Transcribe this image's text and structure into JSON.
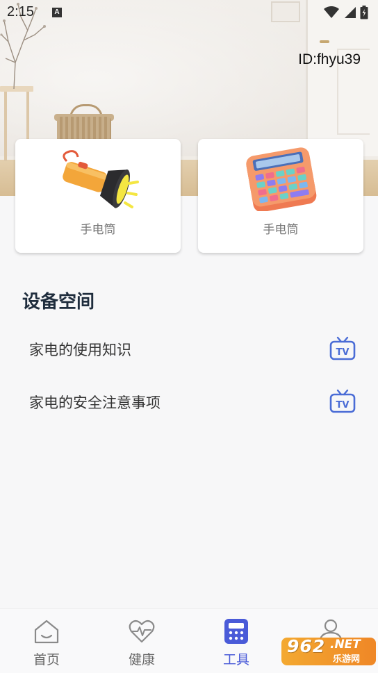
{
  "status_bar": {
    "time": "2:15",
    "notification_icon": "a-icon",
    "wifi_icon": "wifi-icon",
    "signal_icon": "cellular-signal-icon",
    "battery_icon": "battery-icon"
  },
  "header": {
    "user_id": "ID:fhyu39"
  },
  "tool_cards": [
    {
      "label": "手电筒",
      "icon": "flashlight-icon"
    },
    {
      "label": "手电筒",
      "icon": "calculator-icon"
    }
  ],
  "device_space": {
    "title": "设备空间",
    "items": [
      {
        "label": "家电的使用知识",
        "icon": "tv-icon"
      },
      {
        "label": "家电的安全注意事项",
        "icon": "tv-icon"
      }
    ]
  },
  "bottom_nav": {
    "items": [
      {
        "label": "首页",
        "icon": "home-icon"
      },
      {
        "label": "健康",
        "icon": "heart-pulse-icon"
      },
      {
        "label": "工具",
        "icon": "calculator-icon",
        "active": true
      },
      {
        "label": "",
        "icon": "user-icon"
      }
    ]
  },
  "watermark": {
    "main": "962",
    "net": ".NET",
    "sub": "乐游网"
  },
  "colors": {
    "accent": "#4a5bd8",
    "tv_icon": "#4a6cd6",
    "section_title": "#1f2d3d",
    "nav_inactive": "#666666",
    "background": "#f7f7f8"
  }
}
